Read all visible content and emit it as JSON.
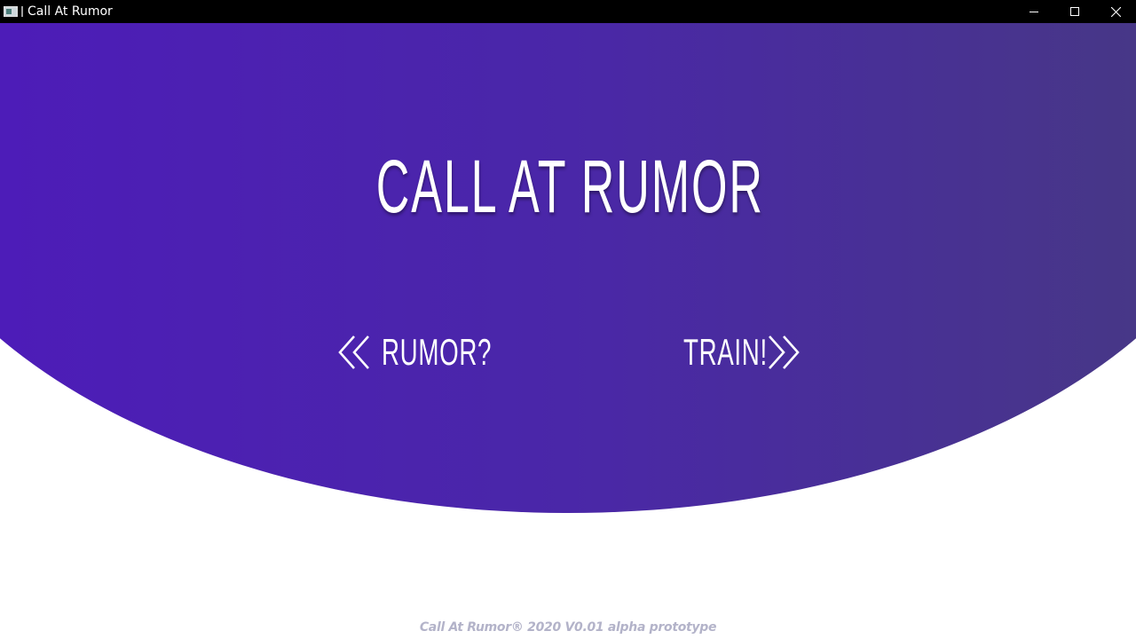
{
  "window": {
    "title": "Call At Rumor",
    "controls": [
      "minimize",
      "maximize",
      "close"
    ]
  },
  "hero": {
    "title": "CALL AT RUMOR",
    "gradient_start": "#4d1cb8",
    "gradient_end": "#473787"
  },
  "nav": {
    "left": {
      "label": "RUMOR?",
      "icon": "double-chevron-left-icon"
    },
    "right": {
      "label": "TRAIN!",
      "icon": "double-chevron-right-icon"
    }
  },
  "footer": {
    "text": "Call At Rumor® 2020 V0.01 alpha prototype",
    "color": "#b3b3c9"
  }
}
